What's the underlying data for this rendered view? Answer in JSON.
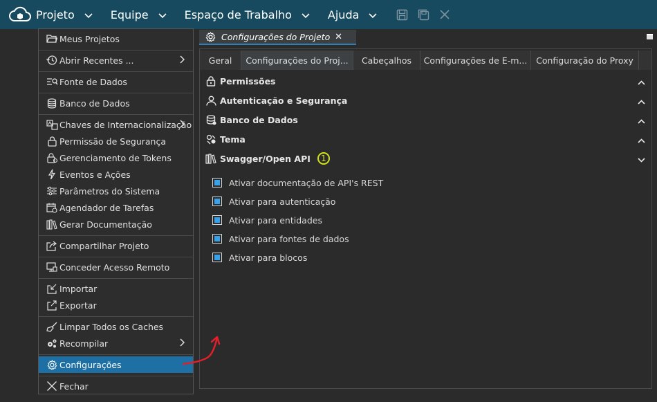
{
  "topbar": {
    "menus": [
      {
        "label": "Projeto"
      },
      {
        "label": "Equipe"
      },
      {
        "label": "Espaço de Trabalho"
      },
      {
        "label": "Ajuda"
      }
    ]
  },
  "dropdown": {
    "items": [
      {
        "label": "Meus Projetos",
        "icon": "folder-open-icon"
      },
      {
        "label": "Abrir Recentes ...",
        "icon": "history-icon",
        "submenu": true
      },
      {
        "label": "Fonte de Dados",
        "icon": "data-source-search-icon"
      },
      {
        "label": "Banco de Dados",
        "icon": "database-icon"
      },
      {
        "label": "Chaves de Internacionalização",
        "icon": "translate-icon",
        "submenu": true
      },
      {
        "label": "Permissão de Segurança",
        "icon": "lock-icon"
      },
      {
        "label": "Gerenciamento de Tokens",
        "icon": "token-lock-icon"
      },
      {
        "label": "Eventos e Ações",
        "icon": "lightning-icon"
      },
      {
        "label": "Parâmetros do Sistema",
        "icon": "sliders-icon"
      },
      {
        "label": "Agendador de Tarefas",
        "icon": "calendar-clock-icon"
      },
      {
        "label": "Gerar Documentação",
        "icon": "books-icon"
      },
      {
        "label": "Compartilhar Projeto",
        "icon": "share-icon"
      },
      {
        "label": "Conceder Acesso Remoto",
        "icon": "remote-access-icon"
      },
      {
        "label": "Importar",
        "icon": "import-icon"
      },
      {
        "label": "Exportar",
        "icon": "export-icon"
      },
      {
        "label": "Limpar Todos os Caches",
        "icon": "broom-icon"
      },
      {
        "label": "Recompilar",
        "icon": "gears-icon",
        "submenu": true
      },
      {
        "label": "Configurações",
        "icon": "gear-icon",
        "active": true
      },
      {
        "label": "Fechar",
        "icon": "close-icon"
      }
    ]
  },
  "doc_tab": {
    "title": "Configurações do Projeto",
    "close": "✕"
  },
  "subtabs": [
    {
      "label": "Geral"
    },
    {
      "label": "Configurações do Proj..."
    },
    {
      "label": "Cabeçalhos"
    },
    {
      "label": "Configurações de E-m..."
    },
    {
      "label": "Configuração do Proxy"
    }
  ],
  "sections": [
    {
      "label": "Permissões",
      "icon": "lock-icon",
      "expanded": false
    },
    {
      "label": "Autenticação e Segurança",
      "icon": "user-icon",
      "expanded": false
    },
    {
      "label": "Banco de Dados",
      "icon": "database-icon",
      "expanded": false
    },
    {
      "label": "Tema",
      "icon": "palette-icon",
      "expanded": false
    },
    {
      "label": "Swagger/Open API",
      "icon": "books-icon",
      "expanded": true,
      "callout": "1"
    }
  ],
  "swagger_options": [
    {
      "label": "Ativar documentação de API's REST",
      "checked": true
    },
    {
      "label": "Ativar para autenticação",
      "checked": true
    },
    {
      "label": "Ativar para entidades",
      "checked": true
    },
    {
      "label": "Ativar para fontes de dados",
      "checked": true
    },
    {
      "label": "Ativar para blocos",
      "checked": true
    }
  ],
  "colors": {
    "topbar": "#174a5e",
    "active_menu": "#1e6fa3",
    "checkbox_fill": "#3aa0e8",
    "callout": "#d4e21b",
    "annotation_arrow": "#e0202a"
  }
}
